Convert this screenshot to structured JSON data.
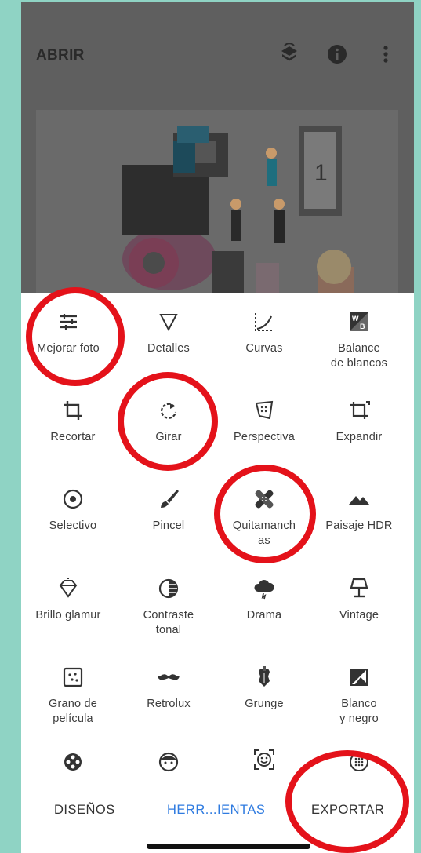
{
  "header": {
    "title": "ABRIR",
    "icons": [
      "layers-sync-icon",
      "info-icon",
      "more-vert-icon"
    ]
  },
  "tools": [
    {
      "label": "Mejorar foto",
      "icon": "tune-sliders-icon"
    },
    {
      "label": "Detalles",
      "icon": "triangle-down-icon"
    },
    {
      "label": "Curvas",
      "icon": "curves-icon"
    },
    {
      "label": "Balance\nde blancos",
      "icon": "white-balance-icon"
    },
    {
      "label": "Recortar",
      "icon": "crop-icon"
    },
    {
      "label": "Girar",
      "icon": "rotate-icon"
    },
    {
      "label": "Perspectiva",
      "icon": "perspective-icon"
    },
    {
      "label": "Expandir",
      "icon": "expand-icon"
    },
    {
      "label": "Selectivo",
      "icon": "target-icon"
    },
    {
      "label": "Pincel",
      "icon": "brush-icon"
    },
    {
      "label": "Quitamanch\nas",
      "icon": "bandage-icon"
    },
    {
      "label": "Paisaje HDR",
      "icon": "mountains-icon"
    },
    {
      "label": "Brillo glamur",
      "icon": "diamond-icon"
    },
    {
      "label": "Contraste\ntonal",
      "icon": "contrast-icon"
    },
    {
      "label": "Drama",
      "icon": "cloud-icon"
    },
    {
      "label": "Vintage",
      "icon": "lamp-icon"
    },
    {
      "label": "Grano de\npelícula",
      "icon": "grain-icon"
    },
    {
      "label": "Retrolux",
      "icon": "mustache-icon"
    },
    {
      "label": "Grunge",
      "icon": "guitar-icon"
    },
    {
      "label": "Blanco\ny negro",
      "icon": "bw-icon"
    },
    {
      "label": "",
      "icon": "film-reel-icon"
    },
    {
      "label": "",
      "icon": "face-icon"
    },
    {
      "label": "",
      "icon": "face-detect-icon"
    },
    {
      "label": "",
      "icon": "dots-circle-icon"
    }
  ],
  "tabs": {
    "designs": "DISEÑOS",
    "tools": "HERR...IENTAS",
    "export": "EXPORTAR"
  },
  "colors": {
    "background": "#8fd3c4",
    "accent": "#2f7be0",
    "annotation": "#e4121a"
  }
}
